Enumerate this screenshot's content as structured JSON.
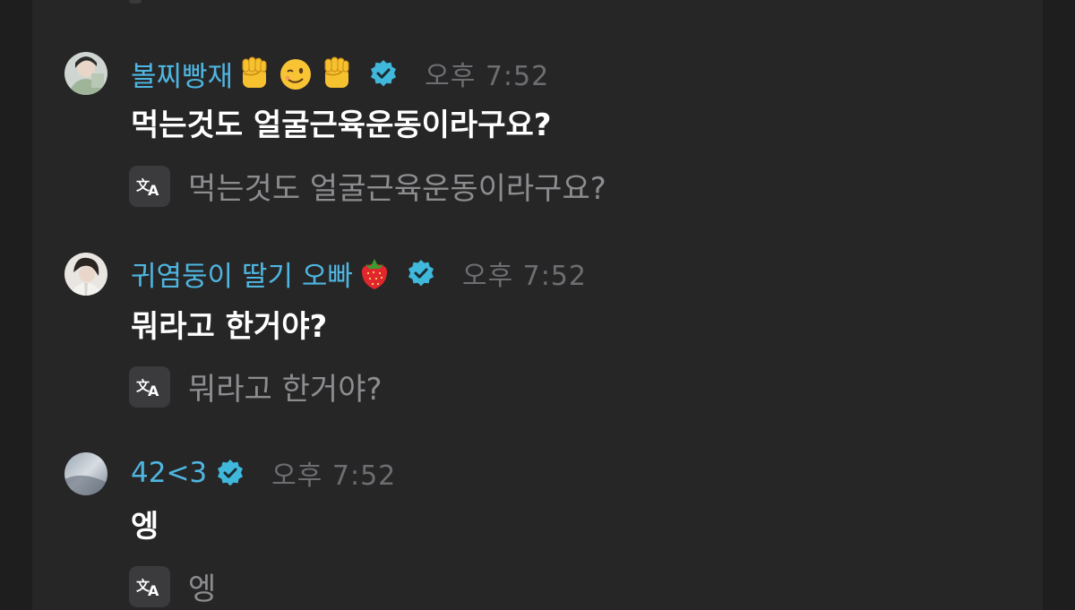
{
  "messages": [
    {
      "username": "볼찌빵재",
      "emojis": [
        "raised-fist",
        "winking-face",
        "raised-fist"
      ],
      "timestamp": "오후 7:52",
      "text": "먹는것도 얼굴근육운동이라구요?",
      "translation": "먹는것도 얼굴근육운동이라구요?"
    },
    {
      "username": "귀염둥이 딸기 오빠",
      "emojis": [
        "strawberry"
      ],
      "timestamp": "오후 7:52",
      "text": "뭐라고 한거야?",
      "translation": "뭐라고 한거야?"
    },
    {
      "username": "42<3",
      "emojis": [],
      "timestamp": "오후 7:52",
      "text": "엥",
      "translation": "엥"
    }
  ],
  "colors": {
    "background": "#262627",
    "username": "#4fb6e0",
    "verified_badge": "#3fb8dc",
    "timestamp": "#6e6e72",
    "message_text": "#ffffff",
    "translation_text": "#8d8d90",
    "translate_button": "#3b3b3d"
  },
  "icons": {
    "verified": "verified-badge-icon",
    "translate": "translate-icon"
  }
}
